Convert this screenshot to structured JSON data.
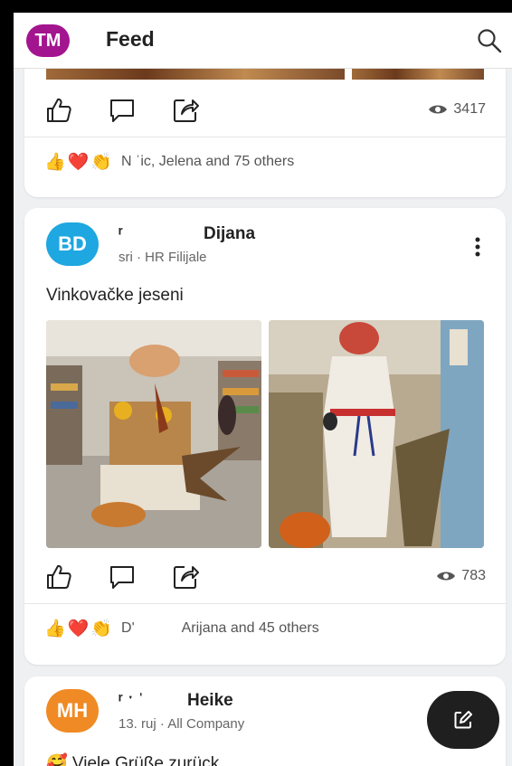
{
  "app": {
    "title": "Feed",
    "user_initials": "TM",
    "avatar_color": "#a3148f",
    "icons": {
      "search": "search-icon",
      "compose": "compose-icon"
    }
  },
  "posts": [
    {
      "views": "3417",
      "reactions": [
        "👍",
        "❤️",
        "👏"
      ],
      "reaction_text": "N    ˈic, Jelena and 75 others"
    },
    {
      "initials": "BD",
      "avatar_color": "#1ea7e0",
      "author": "Dijana",
      "author_prefix": "ʳ",
      "meta": "sri · HR Filijale",
      "text": "Vinkovačke jeseni",
      "views": "783",
      "reactions": [
        "👍",
        "❤️",
        "👏"
      ],
      "reaction_text_prefix": "D'",
      "reaction_text": "Arijana and 45 others"
    },
    {
      "initials": "MH",
      "avatar_color": "#f08a24",
      "author": "Heike",
      "author_prefix": "ʳ ˑ  ˈ",
      "meta": "13. ruj · All Company",
      "text": "🥰 Viele Grüße zurück"
    }
  ]
}
